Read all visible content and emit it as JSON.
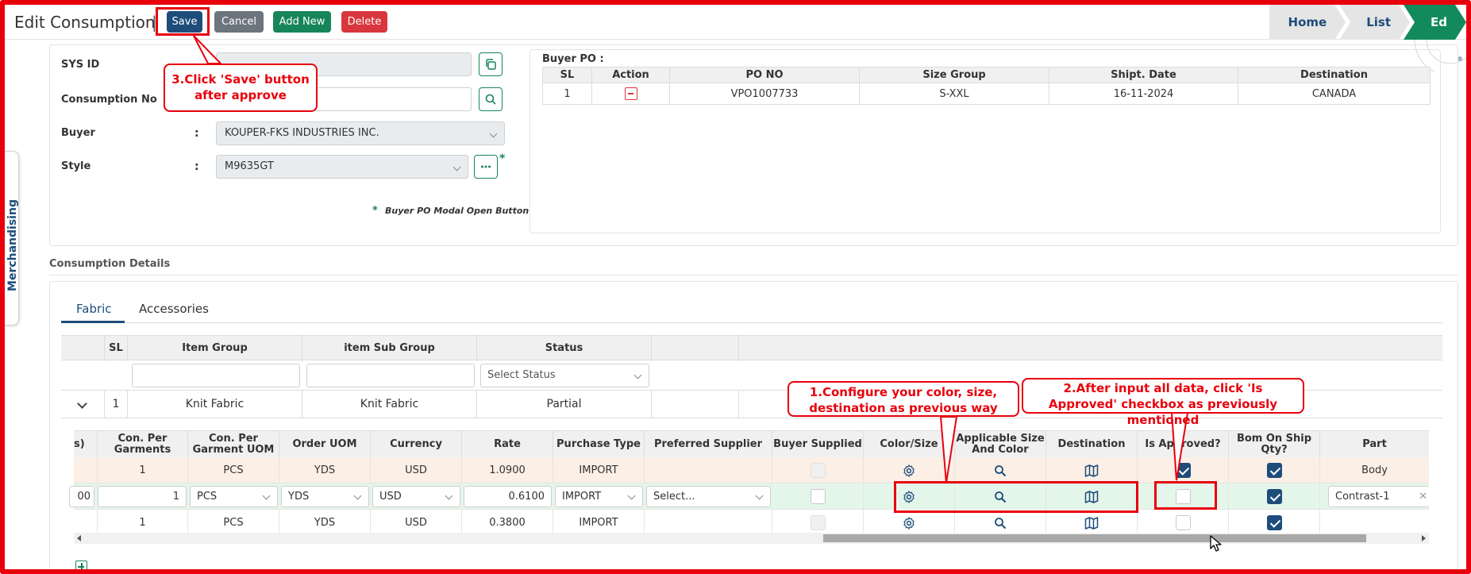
{
  "header": {
    "title": "Edit Consumption",
    "separator": "|",
    "buttons": {
      "save": "Save",
      "cancel": "Cancel",
      "add_new": "Add New",
      "delete": "Delete"
    },
    "breadcrumbs": [
      "Home",
      "List",
      "Ed"
    ]
  },
  "sidebar": {
    "tab_label": "Merchandising"
  },
  "form": {
    "sys_id": {
      "label": "SYS ID",
      "value": ""
    },
    "consumption_no": {
      "label": "Consumption No",
      "value": ""
    },
    "buyer": {
      "label": "Buyer",
      "value": "KOUPER-FKS INDUSTRIES INC."
    },
    "style": {
      "label": "Style",
      "value": "M9635GT"
    },
    "colon": ":",
    "required_star": "*",
    "note_star": "*",
    "note": "Buyer PO Modal Open Button"
  },
  "buyer_po": {
    "title": "Buyer PO :",
    "headers": [
      "SL",
      "Action",
      "PO NO",
      "Size Group",
      "Shipt. Date",
      "Destination"
    ],
    "rows": [
      {
        "sl": "1",
        "po_no": "VPO1007733",
        "size_group": "S-XXL",
        "ship_date": "16-11-2024",
        "destination": "CANADA"
      }
    ]
  },
  "details": {
    "section_title": "Consumption Details",
    "tabs": [
      "Fabric",
      "Accessories"
    ],
    "headers": [
      "SL",
      "Item Group",
      "item Sub Group",
      "Status"
    ],
    "status_placeholder": "Select Status",
    "row": {
      "sl": "1",
      "item_group": "Knit Fabric",
      "item_sub_group": "Knit Fabric",
      "status": "Partial"
    },
    "sub_headers": [
      "s)",
      "Con. Per Garments",
      "Con. Per Garment UOM",
      "Order UOM",
      "Currency",
      "Rate",
      "Purchase Type",
      "Preferred Supplier",
      "Buyer Supplied",
      "Color/Size",
      "Applicable Size And Color",
      "Destination",
      "Is Approved?",
      "Bom On Ship Qty?",
      "Part"
    ],
    "sub_rows": [
      {
        "first": "",
        "con": "1",
        "uom": "PCS",
        "order_uom": "YDS",
        "currency": "USD",
        "rate": "1.0900",
        "purchase": "IMPORT",
        "supplier": "",
        "part": "Body",
        "approved": true,
        "bom": true
      },
      {
        "first": "00",
        "con": "1",
        "uom": "PCS",
        "order_uom": "YDS",
        "currency": "USD",
        "rate": "0.6100",
        "purchase": "IMPORT",
        "supplier": "Select...",
        "part": "Contrast-1",
        "approved": false,
        "bom": true
      },
      {
        "first": "",
        "con": "1",
        "uom": "PCS",
        "order_uom": "YDS",
        "currency": "USD",
        "rate": "0.3800",
        "purchase": "IMPORT",
        "supplier": "",
        "part": "",
        "approved": false,
        "bom": true
      }
    ],
    "clear_glyph": "✕"
  },
  "annotations": {
    "step1": "1.Configure your color, size, destination as previous way",
    "step2": "2.After input all data, click 'Is Approved' checkbox as previously mentioned",
    "step3": "3.Click 'Save' button after approve"
  },
  "colors": {
    "primary": "#1e4d7b",
    "success": "#17855a",
    "danger": "#d9363e",
    "annotation": "#e8000c"
  }
}
